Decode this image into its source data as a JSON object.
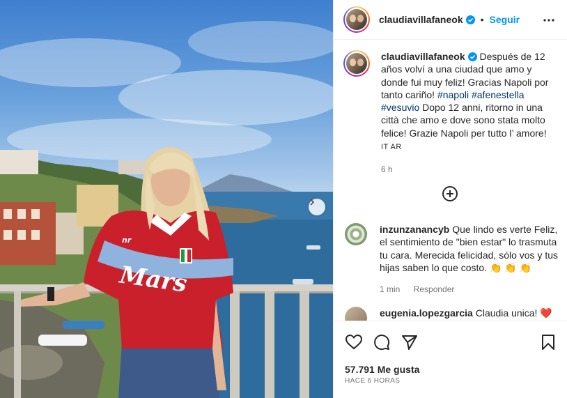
{
  "post": {
    "username": "claudiavillafaneok",
    "follow_label": "Seguir",
    "caption_parts": {
      "p1": "Después de 12 años volví a una ciudad que amo y donde fui muy feliz! Gracias Napoli por tanto cariño! ",
      "tag1": "#napoli",
      "tag2": "#afenestella",
      "tag3": "#vesuvio",
      "p2": " Dopo 12 anni, ritorno in una città che amo e dove sono stata molto felice! Grazie Napoli per tutto l’ amore!"
    },
    "translate": "IT AR",
    "time": "6 h"
  },
  "comments": [
    {
      "username": "inzunzanancyb",
      "text": "Que lindo es verte Feliz, el sentimiento de \"bien estar\" lo trasmuta tu cara. Merecida felicidad, sólo vos y tus hijas saben lo que costo. 👏 👏 👏",
      "time": "1 min",
      "reply_label": "Responder"
    },
    {
      "username": "eugenia.lopezgarcia",
      "text": "Claudia unica! ❤️ ❤️"
    }
  ],
  "footer": {
    "likes": "57.791 Me gusta",
    "ago": "HACE 6 HORAS"
  },
  "photo": {
    "jersey_text": "Mars",
    "brand_text": "nr"
  },
  "colors": {
    "accent": "#0095f6",
    "hashtag": "#00376b",
    "muted": "#737373"
  },
  "icons": [
    "verified-icon",
    "more-icon",
    "add-comment-icon",
    "heart-icon",
    "comment-icon",
    "share-icon",
    "save-icon",
    "next-icon"
  ]
}
